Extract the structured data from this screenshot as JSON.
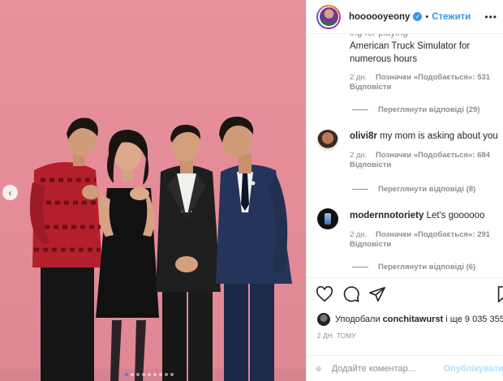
{
  "post": {
    "owner": "hoooooyeony",
    "verified_icon": "verified-badge-icon",
    "separator": "•",
    "follow_label": "Стежити",
    "more_icon": "more-options-icon"
  },
  "photo": {
    "prev_icon": "chevron-left-icon",
    "carousel_count": 9,
    "active_index": 0,
    "background_color": "#e48c98"
  },
  "comments": [
    {
      "text_partial": "American Truck Simulator for numerous hours",
      "time": "2 дн.",
      "likes": "Позначки «Подобається»: 531",
      "reply": "Відповісти",
      "view_replies": "Переглянути відповіді (29)"
    },
    {
      "username": "olivi8r",
      "text": "my mom is asking about you",
      "time": "2 дн.",
      "likes": "Позначки «Подобається»: 684",
      "reply": "Відповісти",
      "view_replies": "Переглянути відповіді (8)"
    },
    {
      "username": "modernnotoriety",
      "text": "Let's goooooo",
      "time": "2 дн.",
      "likes": "Позначки «Подобається»: 291",
      "reply": "Відповісти",
      "view_replies": "Переглянути відповіді (6)"
    }
  ],
  "actions": {
    "like_icon": "heart-icon",
    "comment_icon": "comment-icon",
    "share_icon": "share-icon",
    "save_icon": "bookmark-icon"
  },
  "likes_summary": {
    "prefix": "Уподобали",
    "user": "conchitawurst",
    "suffix": "і ще 9 035 355"
  },
  "time_ago": "2 ДН. ТОМУ",
  "add_comment": {
    "emoji_icon": "emoji-icon",
    "placeholder": "Додайте коментар...",
    "publish_label": "Опублікувати"
  },
  "colors": {
    "accent": "#3897f0",
    "muted": "#8e8e8e",
    "publish_disabled": "#b2dffc"
  }
}
